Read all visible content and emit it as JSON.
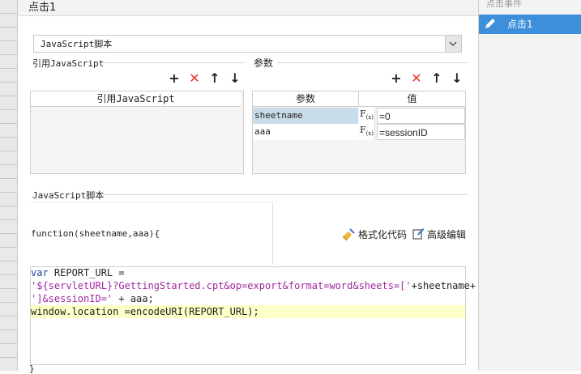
{
  "header": {
    "title": "点击1"
  },
  "right_panel": {
    "title": "点击事件",
    "items": [
      {
        "label": "点击1",
        "selected": true
      }
    ]
  },
  "script_type": {
    "selected": "JavaScript脚本"
  },
  "ref_section": {
    "label": "引用JavaScript",
    "column": "引用JavaScript"
  },
  "params_section": {
    "label": "参数",
    "columns": [
      "参数",
      "值"
    ],
    "rows": [
      {
        "name": "sheetname",
        "value": "=0"
      },
      {
        "name": "aaa",
        "value": "=sessionID"
      }
    ]
  },
  "script_section": {
    "label": "JavaScript脚本",
    "signature": "function(sheetname,aaa){",
    "format_label": "格式化代码",
    "advanced_label": "高级编辑",
    "closing": "}"
  },
  "code": {
    "l1_kw": "var",
    "l1_rest": " REPORT_URL =",
    "l2": "'${servletURL}?GettingStarted.cpt&op=export&format=word&sheets=['",
    "l2_rest": "+sheetname+",
    "l3": "']&sessionID='",
    "l3_rest": " + aaa;",
    "l4_a": "window.location =encodeURI(REPORT_URL);"
  },
  "colors": {
    "accent": "#3d8fdc",
    "delete": "#e03b24",
    "highlight": "#ffffc8",
    "keyword": "#1f3f9f",
    "string": "#a0289f"
  },
  "icons": [
    "edit-icon",
    "plus-icon",
    "delete-icon",
    "up-arrow-icon",
    "down-arrow-icon",
    "fx-icon",
    "broom-icon",
    "edit-doc-icon",
    "chevron-down-icon"
  ]
}
